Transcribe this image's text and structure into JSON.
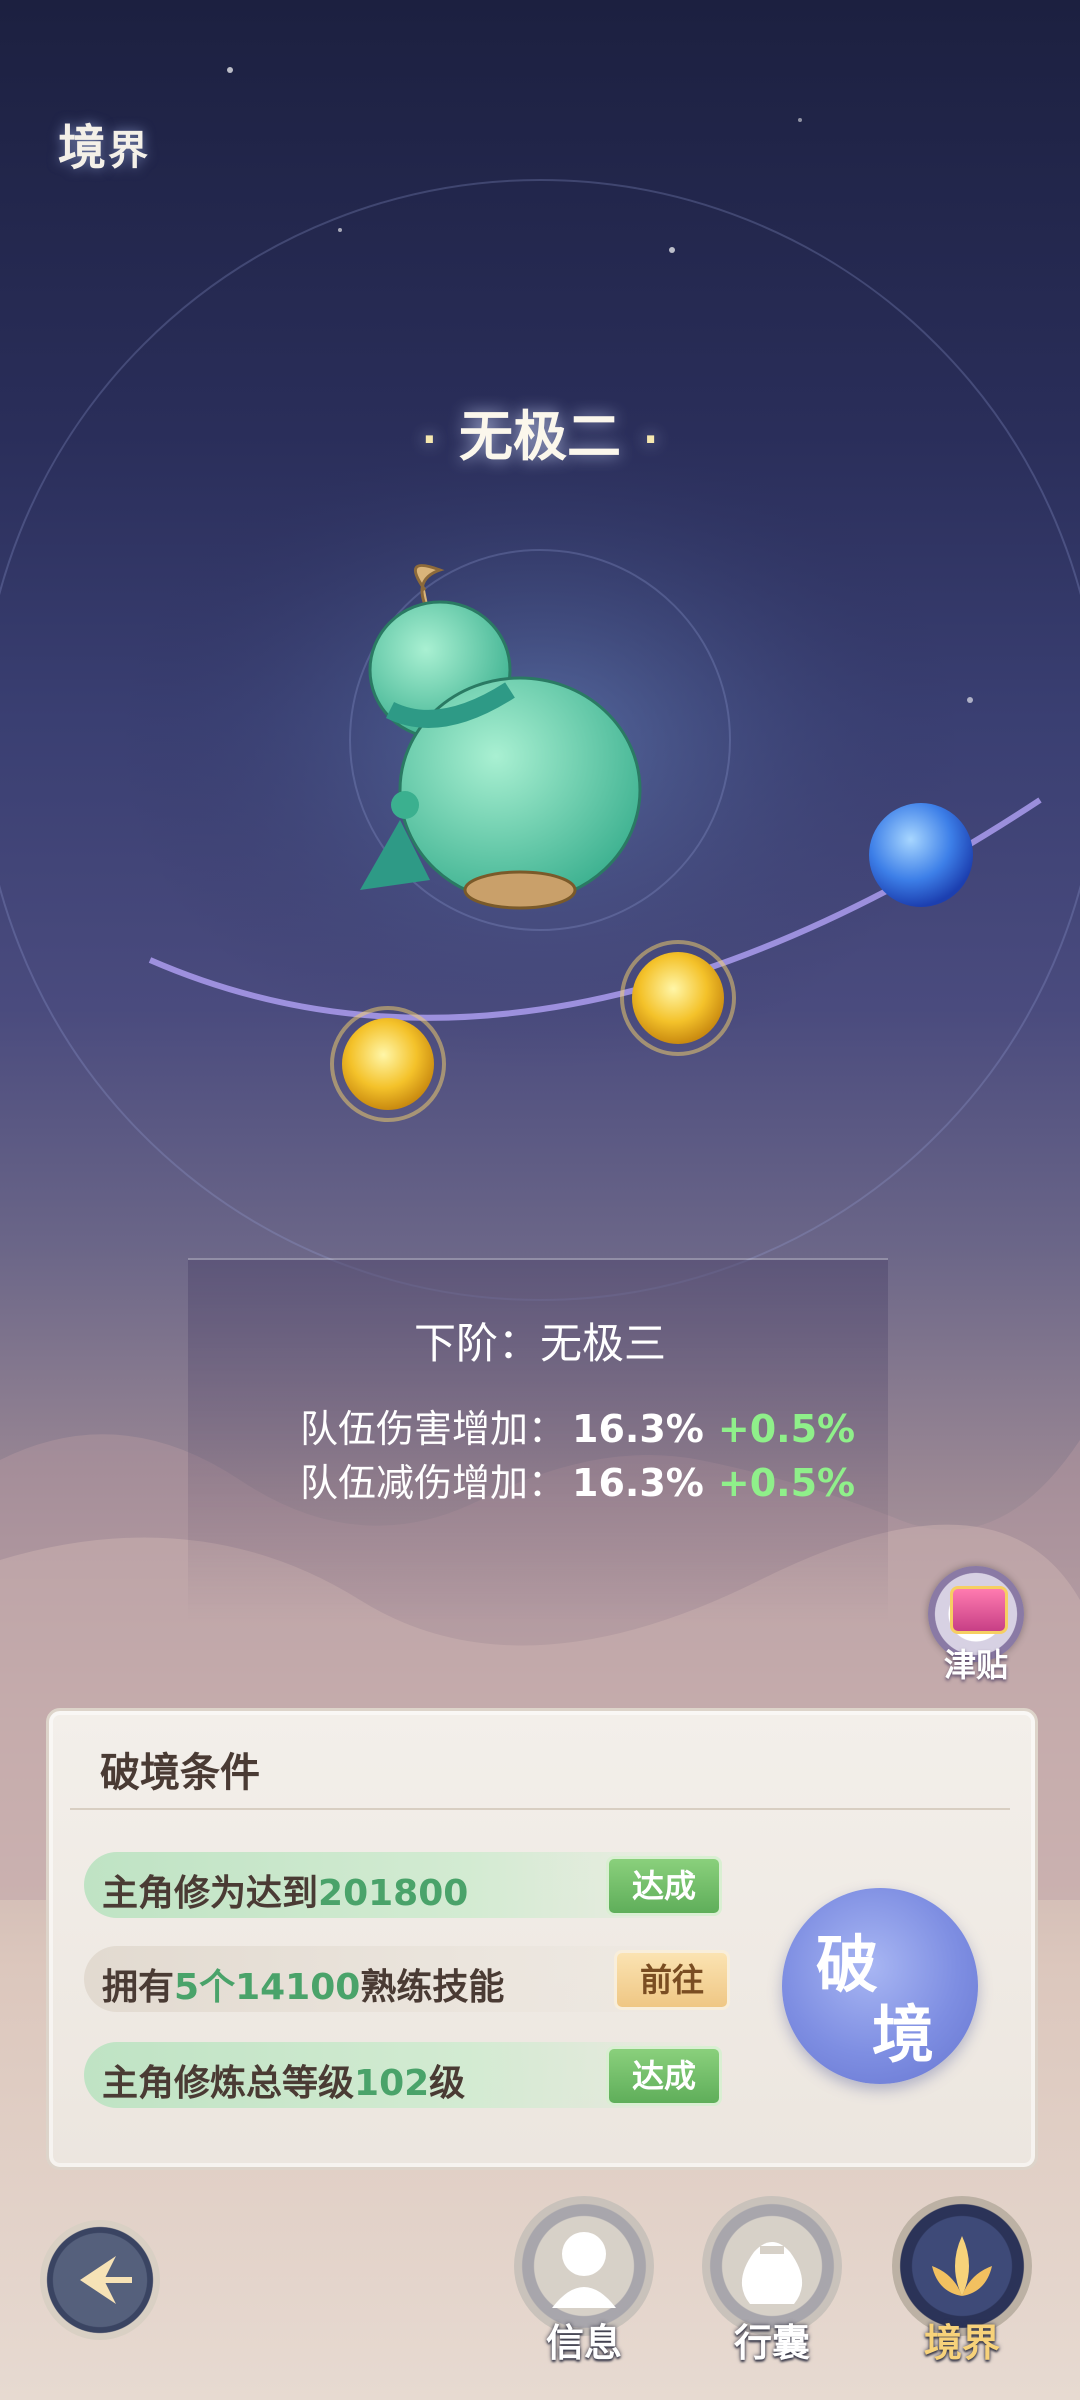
{
  "header": {
    "title_main": "境",
    "title_sub": "界"
  },
  "realm": {
    "current_name": "无极二"
  },
  "stats": {
    "next_tier_label": "下阶：",
    "next_tier_name": "无极三",
    "rows": [
      {
        "label": "队伍伤害增加：",
        "value": "16.3%",
        "increase": "+0.5%"
      },
      {
        "label": "队伍减伤增加：",
        "value": "16.3%",
        "increase": "+0.5%"
      }
    ]
  },
  "subsidy": {
    "label": "津贴"
  },
  "conditions": {
    "title": "破境条件",
    "rows": [
      {
        "prefix": "主角修为达到",
        "highlight": "201800",
        "suffix": "",
        "action": "达成",
        "status": "done"
      },
      {
        "prefix": "拥有",
        "highlight": "5个14100",
        "suffix": "熟练技能",
        "action": "前往",
        "status": "todo"
      },
      {
        "prefix": "主角修炼总等级",
        "highlight": "102",
        "suffix": "级",
        "action": "达成",
        "status": "done"
      }
    ]
  },
  "break_button": {
    "line1": "破",
    "line2": "境"
  },
  "nav": {
    "items": [
      {
        "label": "信息",
        "icon": "character-icon",
        "active": false
      },
      {
        "label": "行囊",
        "icon": "bag-icon",
        "active": false
      },
      {
        "label": "境界",
        "icon": "lotus-icon",
        "active": true
      }
    ]
  },
  "colors": {
    "increase": "#8ff08a",
    "highlight": "#4aa36a",
    "accent_blue": "#7e8ee2"
  }
}
